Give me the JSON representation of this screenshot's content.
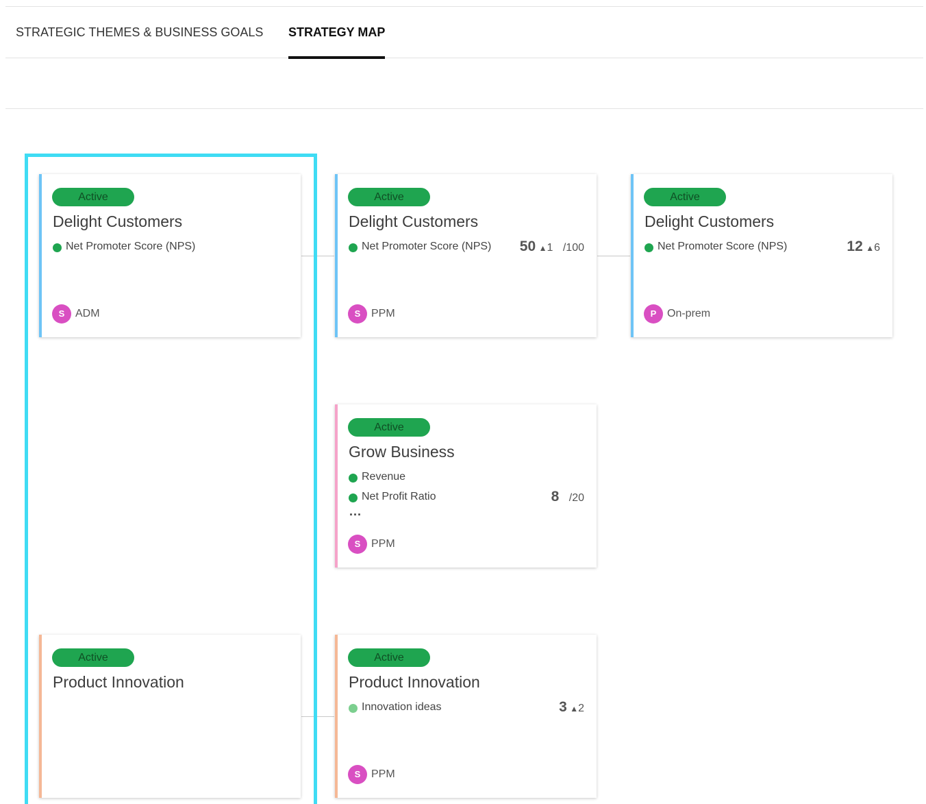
{
  "tabs": [
    {
      "label": "STRATEGIC THEMES & BUSINESS GOALS",
      "active": false
    },
    {
      "label": "STRATEGY MAP",
      "active": true
    }
  ],
  "colors": {
    "status_active": "#1fa550",
    "selection_outline": "#3fdcf4",
    "avatar": "#d94fc2"
  },
  "cards": [
    {
      "status": "Active",
      "title": "Delight Customers",
      "accent": "#6ec4f6",
      "metrics": [
        {
          "name": "Net Promoter Score  (NPS)",
          "value": "",
          "delta": "",
          "target": ""
        }
      ],
      "owner_initial": "S",
      "owner": "ADM"
    },
    {
      "status": "Active",
      "title": "Delight Customers",
      "accent": "#6ec4f6",
      "metrics": [
        {
          "name": "Net Promoter Score  (NPS)",
          "value": "50",
          "delta": "1",
          "target": "/100"
        }
      ],
      "owner_initial": "S",
      "owner": "PPM"
    },
    {
      "status": "Active",
      "title": "Delight Customers",
      "accent": "#6ec4f6",
      "metrics": [
        {
          "name": "Net Promoter Score  (NPS)",
          "value": "12",
          "delta": "6",
          "target": ""
        }
      ],
      "owner_initial": "P",
      "owner": "On-prem"
    },
    {
      "status": "Active",
      "title": "Grow Business",
      "accent": "#f5a3c9",
      "metrics": [
        {
          "name": "Revenue",
          "value": "",
          "delta": "",
          "target": ""
        },
        {
          "name": "Net Profit Ratio",
          "value": "8",
          "delta": "",
          "target": "/20"
        }
      ],
      "more": "...",
      "owner_initial": "S",
      "owner": "PPM"
    },
    {
      "status": "Active",
      "title": "Product Innovation",
      "accent": "#f5b896",
      "metrics": [],
      "owner_initial": "",
      "owner": ""
    },
    {
      "status": "Active",
      "title": "Product Innovation",
      "accent": "#f5b896",
      "metrics": [
        {
          "name": "Innovation ideas",
          "value": "3",
          "delta": "2",
          "target": ""
        }
      ],
      "owner_initial": "S",
      "owner": "PPM"
    }
  ]
}
